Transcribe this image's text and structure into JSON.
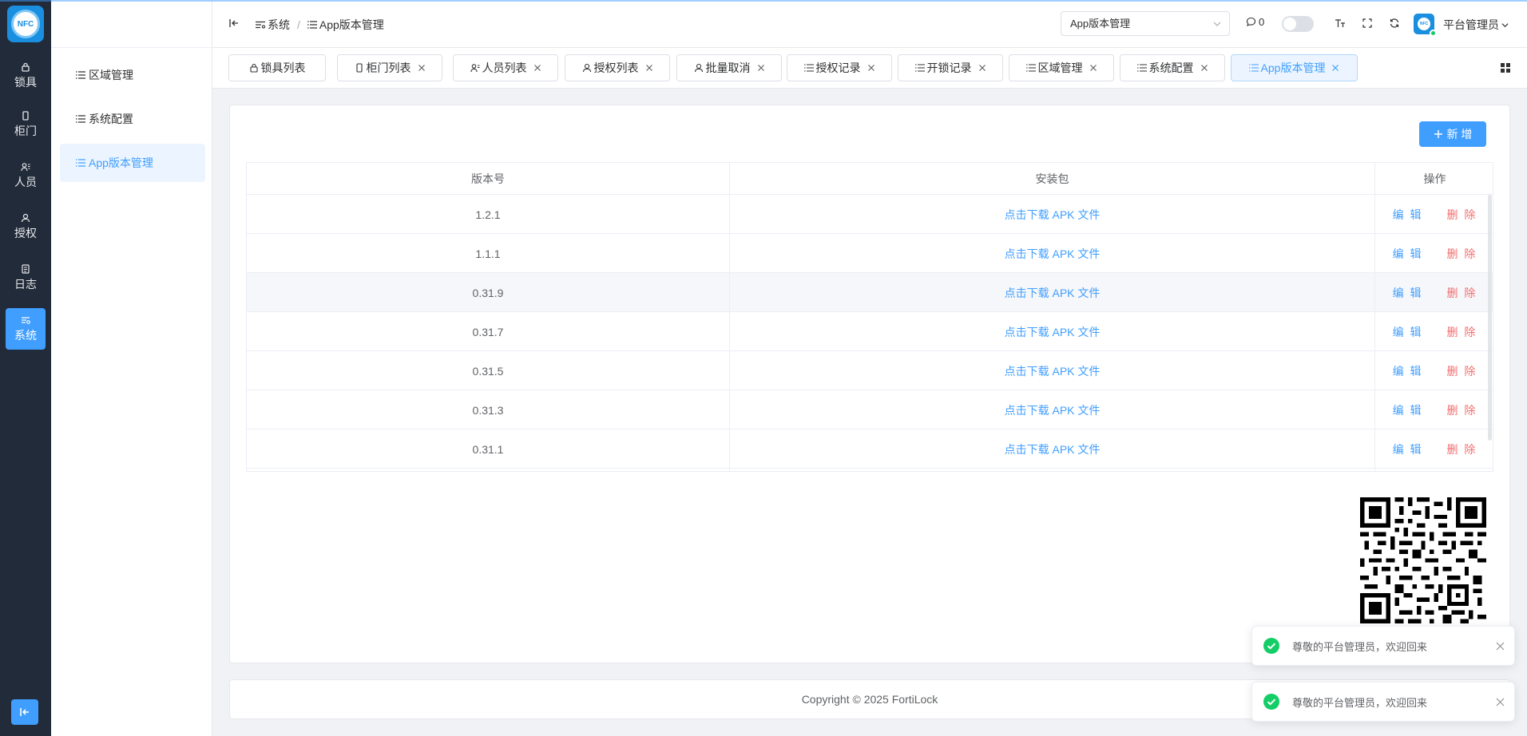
{
  "logo": {
    "text": "NFC"
  },
  "rail": {
    "items": [
      {
        "label": "锁具",
        "icon": "lock-icon"
      },
      {
        "label": "柜门",
        "icon": "door-icon"
      },
      {
        "label": "人员",
        "icon": "people-icon"
      },
      {
        "label": "授权",
        "icon": "authorize-icon"
      },
      {
        "label": "日志",
        "icon": "log-icon"
      },
      {
        "label": "系统",
        "icon": "system-icon"
      }
    ],
    "active": "系统"
  },
  "subnav": {
    "items": [
      {
        "label": "区域管理"
      },
      {
        "label": "系统配置"
      },
      {
        "label": "App版本管理"
      }
    ],
    "active": "App版本管理"
  },
  "header": {
    "breadcrumb": [
      "系统",
      "App版本管理"
    ],
    "select_value": "App版本管理",
    "message_count": "0",
    "user_name": "平台管理员",
    "avatar_text": "NFC"
  },
  "tabs": [
    {
      "label": "锁具列表",
      "closable": false
    },
    {
      "label": "柜门列表",
      "closable": true
    },
    {
      "label": "人员列表",
      "closable": true
    },
    {
      "label": "授权列表",
      "closable": true
    },
    {
      "label": "批量取消",
      "closable": true
    },
    {
      "label": "授权记录",
      "closable": true
    },
    {
      "label": "开锁记录",
      "closable": true
    },
    {
      "label": "区域管理",
      "closable": true
    },
    {
      "label": "系统配置",
      "closable": true
    },
    {
      "label": "App版本管理",
      "closable": true
    }
  ],
  "toolbar": {
    "add_label": "新 增"
  },
  "table": {
    "columns": [
      "版本号",
      "安装包",
      "操作"
    ],
    "rows": [
      {
        "version": "1.2.1",
        "package": "点击下载 APK 文件"
      },
      {
        "version": "1.1.1",
        "package": "点击下载 APK 文件"
      },
      {
        "version": "0.31.9",
        "package": "点击下载 APK 文件"
      },
      {
        "version": "0.31.7",
        "package": "点击下载 APK 文件"
      },
      {
        "version": "0.31.5",
        "package": "点击下载 APK 文件"
      },
      {
        "version": "0.31.3",
        "package": "点击下载 APK 文件"
      },
      {
        "version": "0.31.1",
        "package": "点击下载 APK 文件"
      }
    ],
    "edit_label": "编 辑",
    "delete_label": "删 除"
  },
  "footer": {
    "copyright": "Copyright © 2025 FortiLock"
  },
  "notifications": [
    {
      "text": "尊敬的平台管理员，欢迎回来"
    },
    {
      "text": "尊敬的平台管理员，欢迎回来"
    }
  ],
  "colors": {
    "primary": "#409eff",
    "danger": "#f56c6c",
    "success": "#13ce66",
    "rail": "#222b3a"
  }
}
